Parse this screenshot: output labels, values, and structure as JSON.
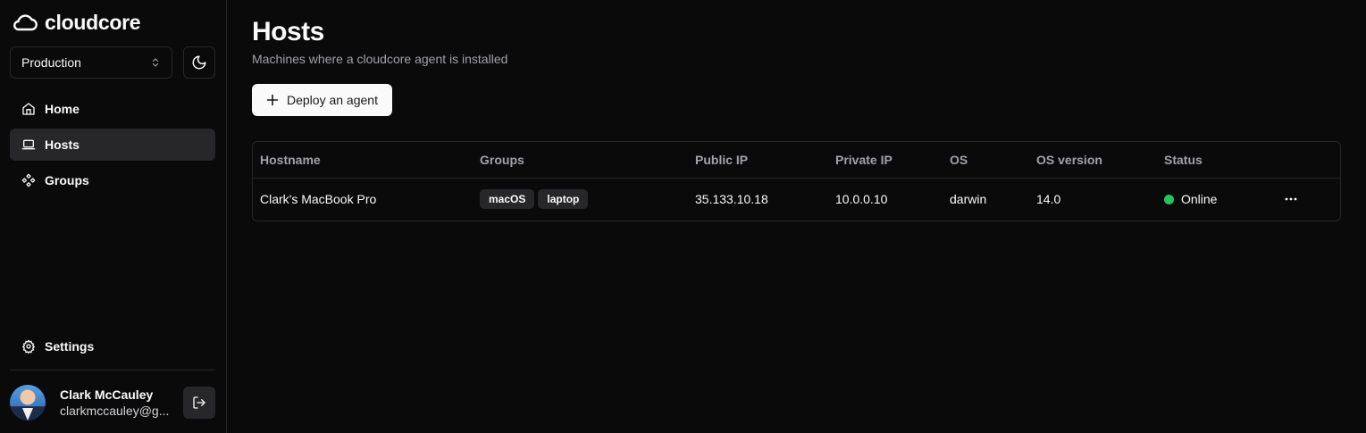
{
  "brand": {
    "name": "cloudcore"
  },
  "environment": {
    "selected": "Production"
  },
  "nav": {
    "home": "Home",
    "hosts": "Hosts",
    "groups": "Groups",
    "settings": "Settings"
  },
  "user": {
    "name": "Clark McCauley",
    "email": "clarkmccauley@g..."
  },
  "page": {
    "title": "Hosts",
    "subtitle": "Machines where a cloudcore agent is installed",
    "deploy_label": "Deploy an agent"
  },
  "table": {
    "columns": [
      "Hostname",
      "Groups",
      "Public IP",
      "Private IP",
      "OS",
      "OS version",
      "Status"
    ],
    "rows": [
      {
        "hostname": "Clark's MacBook Pro",
        "groups": [
          "macOS",
          "laptop"
        ],
        "public_ip": "35.133.10.18",
        "private_ip": "10.0.0.10",
        "os": "darwin",
        "os_version": "14.0",
        "status": "Online"
      }
    ]
  },
  "colors": {
    "background": "#0a0a0a",
    "border": "#27272a",
    "online": "#22c55e"
  }
}
